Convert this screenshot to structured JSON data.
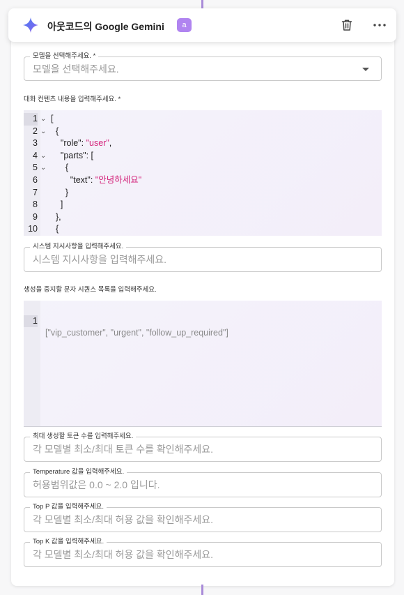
{
  "header": {
    "title": "아웃코드의 Google Gemini",
    "badge": "a"
  },
  "model_select": {
    "legend": "모델을 선택해주세요. *",
    "placeholder": "모델을 선택해주세요."
  },
  "contents": {
    "label": "대화 컨텐츠 내용을 입력해주세요. *",
    "lines": [
      {
        "n": "1",
        "fold": "⌄",
        "indent": "",
        "parts": [
          {
            "t": "[",
            "s": false
          }
        ]
      },
      {
        "n": "2",
        "fold": "⌄",
        "indent": "  ",
        "parts": [
          {
            "t": "{",
            "s": false
          }
        ]
      },
      {
        "n": "3",
        "fold": "",
        "indent": "    ",
        "parts": [
          {
            "t": "\"role\": ",
            "s": false
          },
          {
            "t": "\"user\"",
            "s": true
          },
          {
            "t": ",",
            "s": false
          }
        ]
      },
      {
        "n": "4",
        "fold": "⌄",
        "indent": "    ",
        "parts": [
          {
            "t": "\"parts\": [",
            "s": false
          }
        ]
      },
      {
        "n": "5",
        "fold": "⌄",
        "indent": "      ",
        "parts": [
          {
            "t": "{",
            "s": false
          }
        ]
      },
      {
        "n": "6",
        "fold": "",
        "indent": "        ",
        "parts": [
          {
            "t": "\"text\": ",
            "s": false
          },
          {
            "t": "\"안녕하세요\"",
            "s": true
          }
        ]
      },
      {
        "n": "7",
        "fold": "",
        "indent": "      ",
        "parts": [
          {
            "t": "}",
            "s": false
          }
        ]
      },
      {
        "n": "8",
        "fold": "",
        "indent": "    ",
        "parts": [
          {
            "t": "]",
            "s": false
          }
        ]
      },
      {
        "n": "9",
        "fold": "",
        "indent": "  ",
        "parts": [
          {
            "t": "},",
            "s": false
          }
        ]
      },
      {
        "n": "10",
        "fold": "",
        "indent": "  ",
        "parts": [
          {
            "t": "{",
            "s": false
          }
        ]
      }
    ]
  },
  "system_instruction": {
    "legend": "시스템 지시사항을 입력해주세요.",
    "placeholder": "시스템 지시사항을 입력해주세요."
  },
  "stop_sequences": {
    "label": "생성을 중지할 문자 시퀀스 목록을 입력해주세요.",
    "line_number": "1",
    "placeholder": "[\"vip_customer\", \"urgent\", \"follow_up_required\"]"
  },
  "max_tokens": {
    "legend": "최대 생성할 토큰 수를 입력해주세요.",
    "placeholder": "각 모델별 최소/최대 토큰 수를 확인해주세요."
  },
  "temperature": {
    "legend": "Temperature 값을 입력해주세요.",
    "placeholder": "허용범위값은 0.0 ~ 2.0 입니다."
  },
  "top_p": {
    "legend": "Top P 값을 입력해주세요.",
    "placeholder": "각 모델별 최소/최대 허용 값을 확인해주세요."
  },
  "top_k": {
    "legend": "Top K 값을 입력해주세요.",
    "placeholder": "각 모델별 최소/최대 허용 값을 확인해주세요."
  },
  "icons": {
    "gemini": "gemini-sparkle-icon",
    "trash": "trash-icon",
    "more": "more-horizontal-icon",
    "caret": "caret-down-icon"
  },
  "colors": {
    "accent": "#b084f0",
    "string": "#d4237a",
    "connector": "#a98bd9"
  }
}
